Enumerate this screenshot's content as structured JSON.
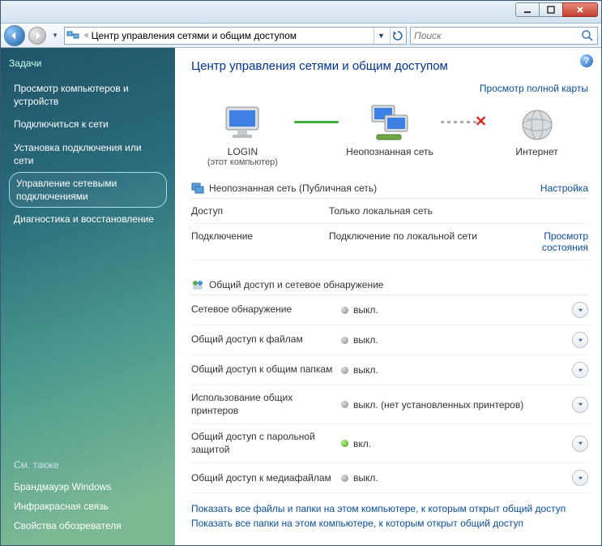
{
  "address": {
    "prefix": "«",
    "text": "Центр управления сетями и общим доступом"
  },
  "search": {
    "placeholder": "Поиск"
  },
  "sidebar": {
    "tasks_header": "Задачи",
    "items": [
      "Просмотр компьютеров и устройств",
      "Подключиться к сети",
      "Установка подключения или сети",
      "Управление сетевыми подключениями",
      "Диагностика и восстановление"
    ],
    "also_header": "См. также",
    "also": [
      "Брандмауэр Windows",
      "Инфракрасная связь",
      "Свойства обозревателя"
    ]
  },
  "page": {
    "title": "Центр управления сетями и общим доступом",
    "full_map": "Просмотр полной карты",
    "nodes": {
      "pc_name": "LOGIN",
      "pc_sub": "(этот компьютер)",
      "net_name": "Неопознанная сеть",
      "internet": "Интернет"
    }
  },
  "network": {
    "header": "Неопознанная сеть (Публичная сеть)",
    "settings": "Настройка",
    "rows": {
      "access_k": "Доступ",
      "access_v": "Только локальная сеть",
      "conn_k": "Подключение",
      "conn_v": "Подключение по локальной сети",
      "conn_link": "Просмотр состояния"
    }
  },
  "sharing": {
    "header": "Общий доступ и сетевое обнаружение",
    "off": "выкл.",
    "on": "вкл.",
    "rows": [
      {
        "k": "Сетевое обнаружение",
        "v": "выкл.",
        "on": false
      },
      {
        "k": "Общий доступ к файлам",
        "v": "выкл.",
        "on": false
      },
      {
        "k": "Общий доступ к общим папкам",
        "v": "выкл.",
        "on": false
      },
      {
        "k": "Использование общих принтеров",
        "v": "выкл. (нет установленных принтеров)",
        "on": false
      },
      {
        "k": "Общий доступ с парольной защитой",
        "v": "вкл.",
        "on": true
      },
      {
        "k": "Общий доступ к медиафайлам",
        "v": "выкл.",
        "on": false
      }
    ]
  },
  "footer": {
    "l1": "Показать все файлы и папки на этом компьютере, к которым открыт общий доступ",
    "l2": "Показать все папки на этом компьютере, к которым открыт общий доступ"
  }
}
